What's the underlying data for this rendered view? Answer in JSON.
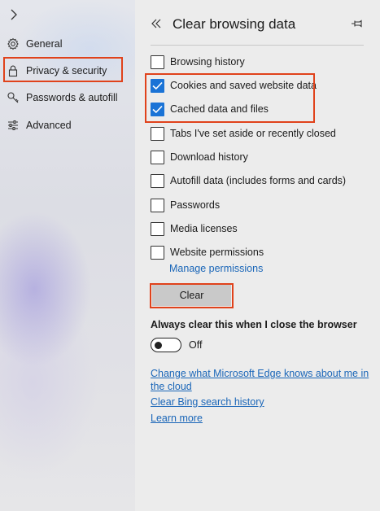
{
  "sidebar": {
    "items": [
      {
        "label": "General",
        "icon": "gear-icon"
      },
      {
        "label": "Privacy & security",
        "icon": "lock-icon"
      },
      {
        "label": "Passwords & autofill",
        "icon": "key-icon"
      },
      {
        "label": "Advanced",
        "icon": "sliders-icon"
      }
    ]
  },
  "panel": {
    "title": "Clear browsing data",
    "checkboxes": [
      {
        "label": "Browsing history",
        "checked": false
      },
      {
        "label": "Cookies and saved website data",
        "checked": true
      },
      {
        "label": "Cached data and files",
        "checked": true
      },
      {
        "label": "Tabs I've set aside or recently closed",
        "checked": false
      },
      {
        "label": "Download history",
        "checked": false
      },
      {
        "label": "Autofill data (includes forms and cards)",
        "checked": false
      },
      {
        "label": "Passwords",
        "checked": false
      },
      {
        "label": "Media licenses",
        "checked": false
      },
      {
        "label": "Website permissions",
        "checked": false
      }
    ],
    "manage_permissions": "Manage permissions",
    "clear_button": "Clear",
    "always_clear_label": "Always clear this when I close the browser",
    "toggle": {
      "state": "Off"
    },
    "links": {
      "change_line1": "Change what Microsoft Edge knows about me in",
      "change_line2": "the cloud",
      "clear_bing": "Clear Bing search history",
      "learn_more": "Learn more"
    }
  },
  "colors": {
    "accent": "#1a73d6",
    "highlight": "#e0421b",
    "link": "#1a66b8"
  }
}
